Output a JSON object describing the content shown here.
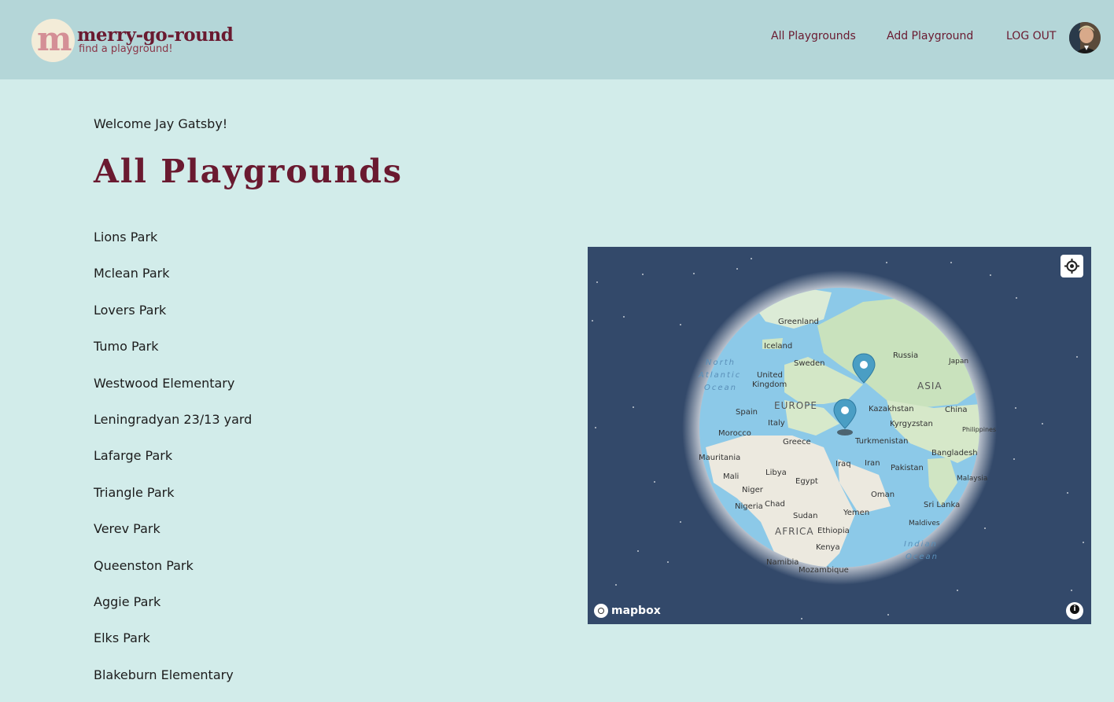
{
  "brand": {
    "logo_letter": "m",
    "name": "merry-go-round",
    "tagline": "find a playground!"
  },
  "nav": {
    "all_playgrounds": "All Playgrounds",
    "add_playground": "Add Playground",
    "logout": "LOG OUT"
  },
  "welcome": "Welcome Jay Gatsby!",
  "page_title": "All Playgrounds",
  "playgrounds": [
    "Lions Park",
    "Mclean Park",
    "Lovers Park",
    "Tumo Park",
    "Westwood Elementary",
    "Leningradyan 23/13 yard",
    "Lafarge Park",
    "Triangle Park",
    "Verev Park",
    "Queenston Park",
    "Aggie Park",
    "Elks Park",
    "Blakeburn Elementary"
  ],
  "map": {
    "attribution": "mapbox",
    "labels": {
      "greenland": "Greenland",
      "iceland": "Iceland",
      "russia": "Russia",
      "japan": "Japan",
      "north": "North",
      "atlantic": "Atlantic",
      "ocean": "Ocean",
      "sweden": "Sweden",
      "united": "United",
      "kingdom": "Kingdom",
      "asia": "ASIA",
      "europe": "EUROPE",
      "kazakhstan": "Kazakhstan",
      "china": "China",
      "spain": "Spain",
      "italy": "Italy",
      "kyrgyzstan": "Kyrgyzstan",
      "philippines": "Philippines",
      "morocco": "Morocco",
      "greece": "Greece",
      "turkmenistan": "Turkmenistan",
      "bangladesh": "Bangladesh",
      "mauritania": "Mauritania",
      "iraq": "Iraq",
      "iran": "Iran",
      "pakistan": "Pakistan",
      "mali": "Mali",
      "libya": "Libya",
      "egypt": "Egypt",
      "malaysia": "Malaysia",
      "niger": "Niger",
      "oman": "Oman",
      "nigeria": "Nigeria",
      "chad": "Chad",
      "sri_lanka": "Sri Lanka",
      "sudan": "Sudan",
      "yemen": "Yemen",
      "maldives": "Maldives",
      "africa": "AFRICA",
      "ethiopia": "Ethiopia",
      "kenya": "Kenya",
      "indian": "Indian",
      "namibia": "Namibia",
      "mozambique": "Mozambique"
    }
  },
  "colors": {
    "page_bg": "#d2ecea",
    "navbar_bg": "#b4d6d8",
    "brand": "#6a1a30",
    "map_bg": "#33496a",
    "marker": "#4a9ec4"
  }
}
